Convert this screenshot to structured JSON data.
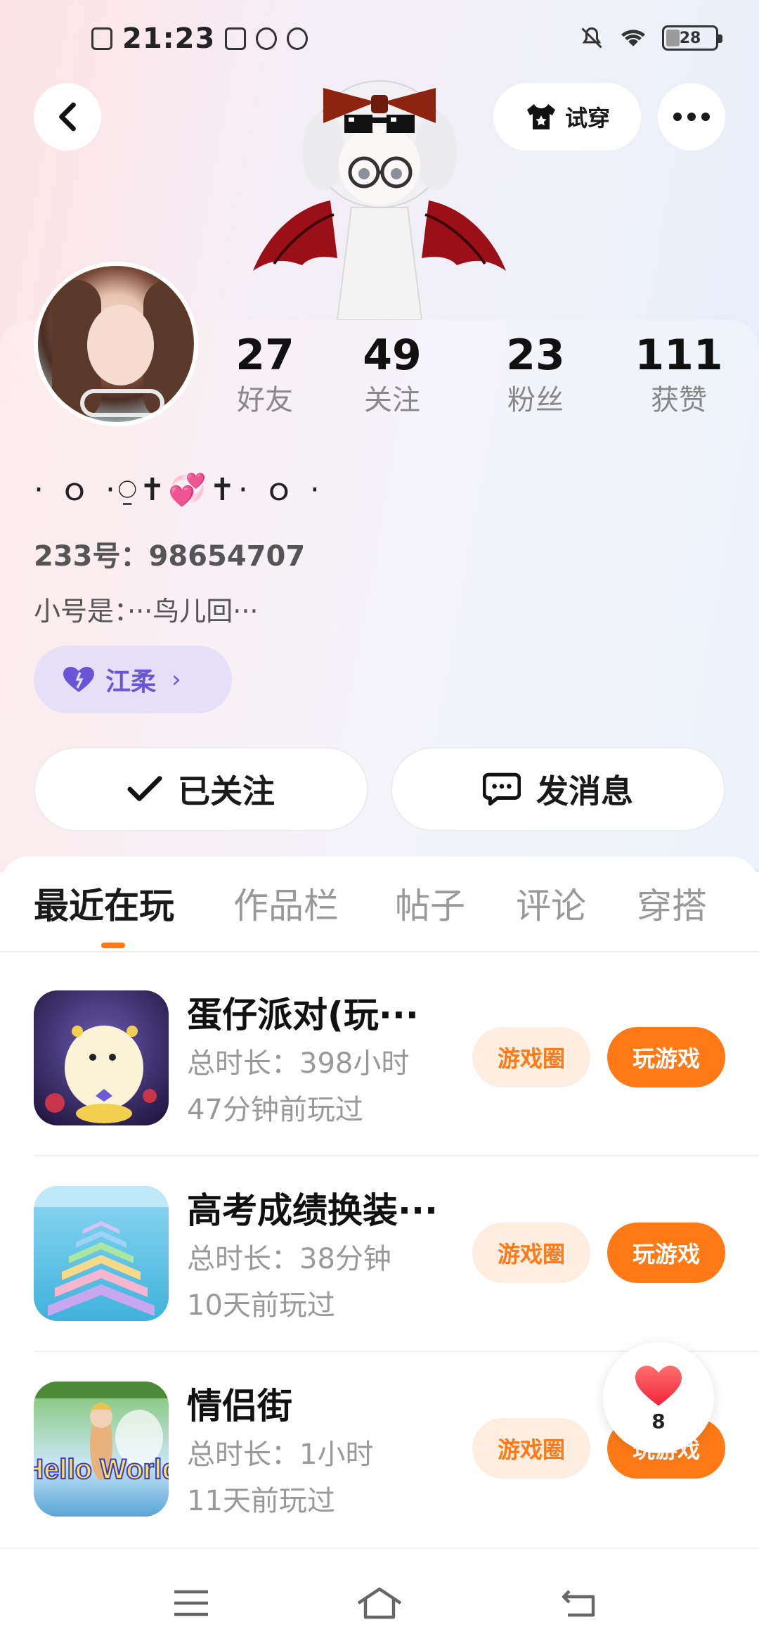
{
  "status_bar": {
    "time": "21:23",
    "battery": "28"
  },
  "header": {
    "tryon_label": "试穿"
  },
  "profile": {
    "stats": [
      {
        "value": "27",
        "label": "好友"
      },
      {
        "value": "49",
        "label": "关注"
      },
      {
        "value": "23",
        "label": "粉丝"
      },
      {
        "value": "111",
        "label": "获赞"
      }
    ],
    "nickname": "·  ｏ  ·⍜✝💞✝·    ｏ ·",
    "uid": "233号：98654707",
    "bio": "小号是：···鸟儿回···",
    "tag_label": "江柔",
    "follow_label": "已关注",
    "message_label": "发消息"
  },
  "tabs": [
    {
      "label": "最近在玩",
      "active": true
    },
    {
      "label": "作品栏",
      "active": false
    },
    {
      "label": "帖子",
      "active": false
    },
    {
      "label": "评论",
      "active": false
    },
    {
      "label": "穿搭",
      "active": false
    }
  ],
  "games": [
    {
      "title": "蛋仔派对(玩···",
      "duration": "总时长：398小时",
      "last_played": "47分钟前玩过",
      "circle_label": "游戏圈",
      "play_label": "玩游戏"
    },
    {
      "title": "高考成绩换装···",
      "duration": "总时长：38分钟",
      "last_played": "10天前玩过",
      "circle_label": "游戏圈",
      "play_label": "玩游戏"
    },
    {
      "title": "情侣街",
      "duration": "总时长：1小时",
      "last_played": "11天前玩过",
      "circle_label": "游戏圈",
      "play_label": "玩游戏"
    }
  ],
  "game3_icon_text": "Hello World",
  "like_count": "8",
  "colors": {
    "accent": "#ff7a16",
    "tag_purple": "#6a55d6"
  }
}
